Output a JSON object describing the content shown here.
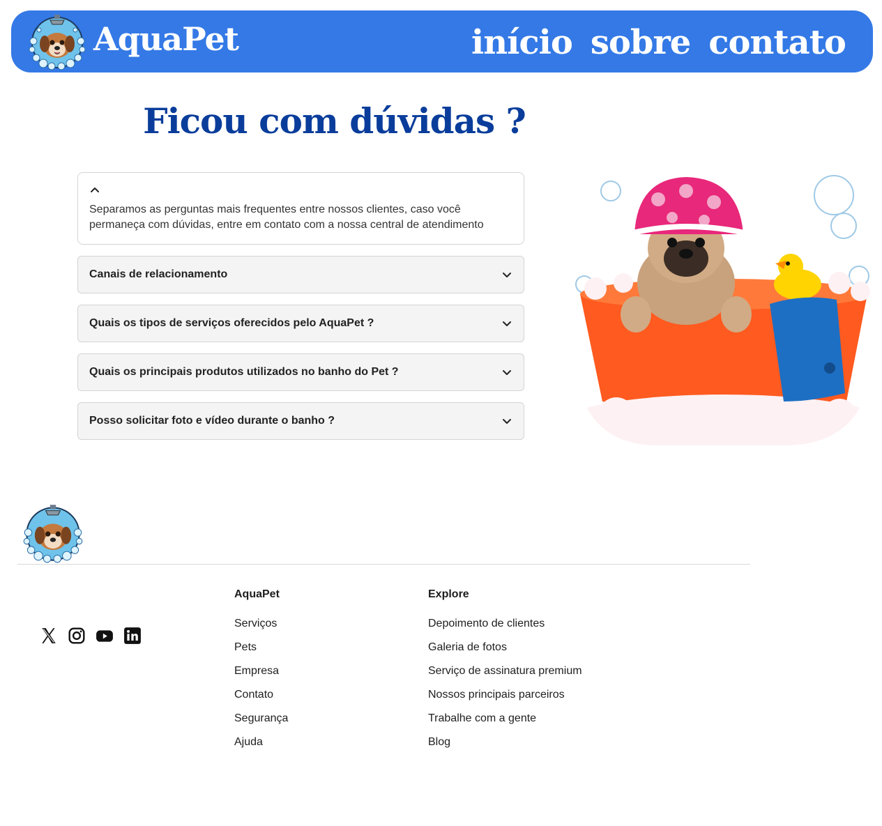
{
  "header": {
    "brand": "AquaPet",
    "nav": [
      "início",
      "sobre",
      "contato"
    ],
    "color": "#3479e6"
  },
  "faq": {
    "title": "Ficou com dúvidas ?",
    "intro": "Separamos as perguntas mais frequentes entre nossos clientes, caso você permaneça com dúvidas, entre em contato com a nossa central de atendimento",
    "items": [
      "Canais de relacionamento",
      "Quais os tipos de serviços oferecidos pelo AquaPet ?",
      "Quais os principais produtos utilizados no banho do Pet ?",
      "Posso solicitar foto e vídeo durante o banho ?"
    ]
  },
  "footer": {
    "socials": [
      "x-icon",
      "instagram-icon",
      "youtube-icon",
      "linkedin-icon"
    ],
    "col1": {
      "title": "AquaPet",
      "links": [
        "Serviços",
        "Pets",
        "Empresa",
        "Contato",
        "Segurança",
        "Ajuda"
      ]
    },
    "col2": {
      "title": "Explore",
      "links": [
        "Depoimento de clientes",
        "Galeria de fotos",
        "Serviço de assinatura premium",
        "Nossos principais parceiros",
        "Trabalhe com a gente",
        "Blog"
      ]
    }
  }
}
